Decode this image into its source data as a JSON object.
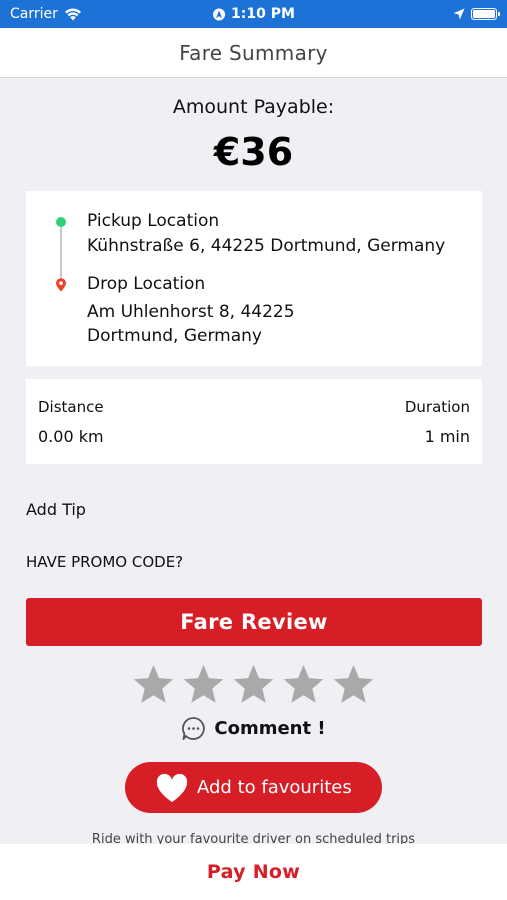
{
  "status_bar": {
    "carrier": "Carrier",
    "time": "1:10 PM",
    "icons": [
      "wifi-icon",
      "location-circle-icon",
      "location-arrow-icon",
      "battery-icon"
    ]
  },
  "header": {
    "title": "Fare Summary"
  },
  "amount": {
    "label": "Amount Payable:",
    "value": "€36"
  },
  "route": {
    "pickup_title": "Pickup Location",
    "pickup_address": "Kühnstraße 6, 44225 Dortmund, Germany",
    "drop_title": "Drop Location",
    "drop_address_line1": "Am Uhlenhorst 8, 44225",
    "drop_address_line2": "Dortmund, Germany"
  },
  "trip": {
    "distance_label": "Distance",
    "distance_value": "0.00 km",
    "duration_label": "Duration",
    "duration_value": "1 min"
  },
  "add_tip_label": "Add Tip",
  "promo_label": "HAVE PROMO CODE?",
  "fare_review_label": "Fare Review",
  "rating": {
    "max": 5,
    "value": 0
  },
  "comment_label": "Comment !",
  "favourites": {
    "button_label": "Add to favourites",
    "note": "Ride with your favourite driver on scheduled trips"
  },
  "pay_now_label": "Pay Now",
  "colors": {
    "status_bar": "#1d72d8",
    "accent_red": "#d71d25",
    "pickup_green": "#2fd175",
    "star_gray": "#a9a9a9",
    "background": "#efeff4"
  }
}
